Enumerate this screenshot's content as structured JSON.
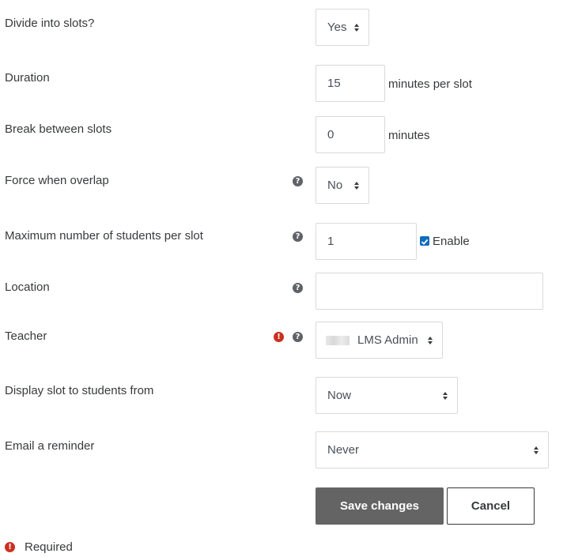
{
  "form": {
    "divide_slots": {
      "label": "Divide into slots?",
      "value": "Yes"
    },
    "duration": {
      "label": "Duration",
      "value": "15",
      "suffix": "minutes per slot"
    },
    "break": {
      "label": "Break between slots",
      "value": "0",
      "suffix": "minutes"
    },
    "force_overlap": {
      "label": "Force when overlap",
      "value": "No"
    },
    "max_students": {
      "label": "Maximum number of students per slot",
      "value": "1",
      "enable_label": "Enable",
      "enable_checked": true
    },
    "location": {
      "label": "Location",
      "value": ""
    },
    "teacher": {
      "label": "Teacher",
      "value": "LMS Admin"
    },
    "display_from": {
      "label": "Display slot to students from",
      "value": "Now"
    },
    "email_reminder": {
      "label": "Email a reminder",
      "value": "Never"
    }
  },
  "buttons": {
    "save": "Save changes",
    "cancel": "Cancel"
  },
  "required_note": "Required",
  "icons": {
    "help": "question-circle-icon",
    "required": "exclamation-circle-icon",
    "select_arrow": "sort-arrows-icon"
  },
  "colors": {
    "primary_button": "#646464",
    "required": "#ca3120",
    "help": "#5f6368",
    "checkbox": "#0f6cbf"
  }
}
